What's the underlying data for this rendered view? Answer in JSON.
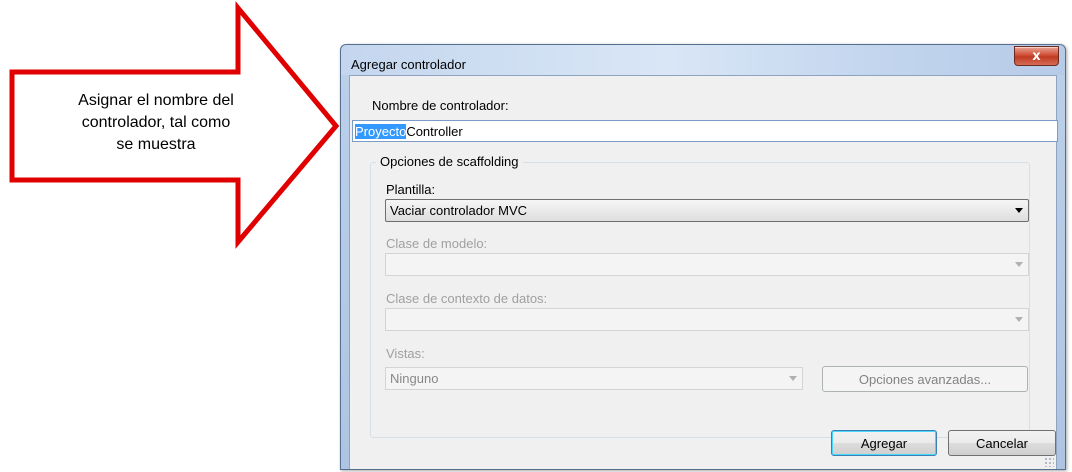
{
  "callout": {
    "lines": [
      "Asignar el nombre del",
      "controlador, tal como",
      "se muestra"
    ],
    "color": "#e00000"
  },
  "dialog": {
    "title": "Agregar controlador",
    "close_glyph": "x",
    "name_label": "Nombre de controlador:",
    "name_selected": "Proyecto",
    "name_rest": "Controller",
    "scaffolding_group": "Opciones de scaffolding",
    "template_label": "Plantilla:",
    "template_value": "Vaciar controlador MVC",
    "model_label": "Clase de modelo:",
    "model_value": "",
    "context_label": "Clase de contexto de datos:",
    "context_value": "",
    "views_label": "Vistas:",
    "views_value": "Ninguno",
    "advanced_button": "Opciones avanzadas...",
    "add_button": "Agregar",
    "cancel_button": "Cancelar"
  },
  "colors": {
    "selection": "#3399ff",
    "arrow_outline": "#e00000"
  }
}
